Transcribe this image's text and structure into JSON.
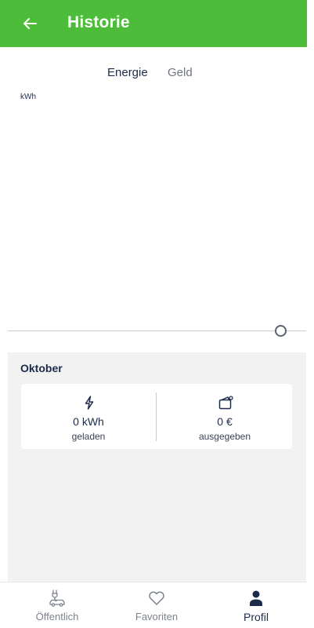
{
  "header": {
    "title": "Historie",
    "back_icon": "arrow-left-icon"
  },
  "tabs": [
    {
      "label": "Energie",
      "active": true
    },
    {
      "label": "Geld",
      "active": false
    }
  ],
  "chart": {
    "unit_label": "kWh"
  },
  "summary": {
    "month": "Oktober",
    "energy": {
      "value": "0 kWh",
      "label": "geladen",
      "icon": "lightning-icon"
    },
    "money": {
      "value": "0 €",
      "label": "ausgegeben",
      "icon": "wallet-icon"
    }
  },
  "bottom_nav": [
    {
      "label": "Öffentlich",
      "icon": "car-charging-icon",
      "active": false
    },
    {
      "label": "Favoriten",
      "icon": "heart-icon",
      "active": false
    },
    {
      "label": "Profil",
      "icon": "person-icon",
      "active": true
    }
  ],
  "colors": {
    "accent_green": "#4cbc3a",
    "navy": "#1c2b4a",
    "muted": "#7d838c",
    "panel": "#f2f2f2"
  }
}
